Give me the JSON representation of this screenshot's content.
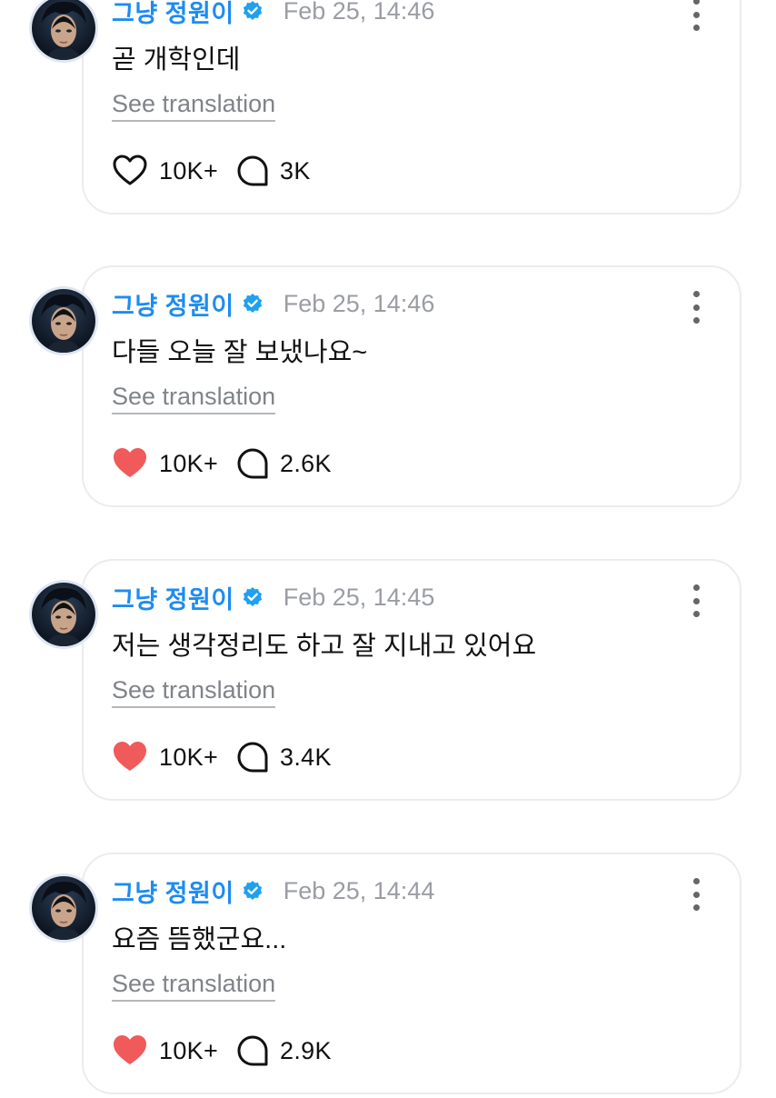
{
  "colors": {
    "username": "#1d8cf0",
    "like_active": "#f05a5a",
    "muted": "#9a9da3"
  },
  "posts": [
    {
      "username": "그냥 정원이",
      "verified": true,
      "timestamp": "Feb 25, 14:46",
      "text": "곧 개학인데",
      "translate_label": "See translation",
      "liked": false,
      "likes": "10K+",
      "replies": "3K"
    },
    {
      "username": "그냥 정원이",
      "verified": true,
      "timestamp": "Feb 25, 14:46",
      "text": "다들 오늘 잘 보냈나요~",
      "translate_label": "See translation",
      "liked": true,
      "likes": "10K+",
      "replies": "2.6K"
    },
    {
      "username": "그냥 정원이",
      "verified": true,
      "timestamp": "Feb 25, 14:45",
      "text": "저는 생각정리도 하고 잘 지내고 있어요",
      "translate_label": "See translation",
      "liked": true,
      "likes": "10K+",
      "replies": "3.4K"
    },
    {
      "username": "그냥 정원이",
      "verified": true,
      "timestamp": "Feb 25, 14:44",
      "text": "요즘 뜸했군요...",
      "translate_label": "See translation",
      "liked": true,
      "likes": "10K+",
      "replies": "2.9K"
    }
  ]
}
